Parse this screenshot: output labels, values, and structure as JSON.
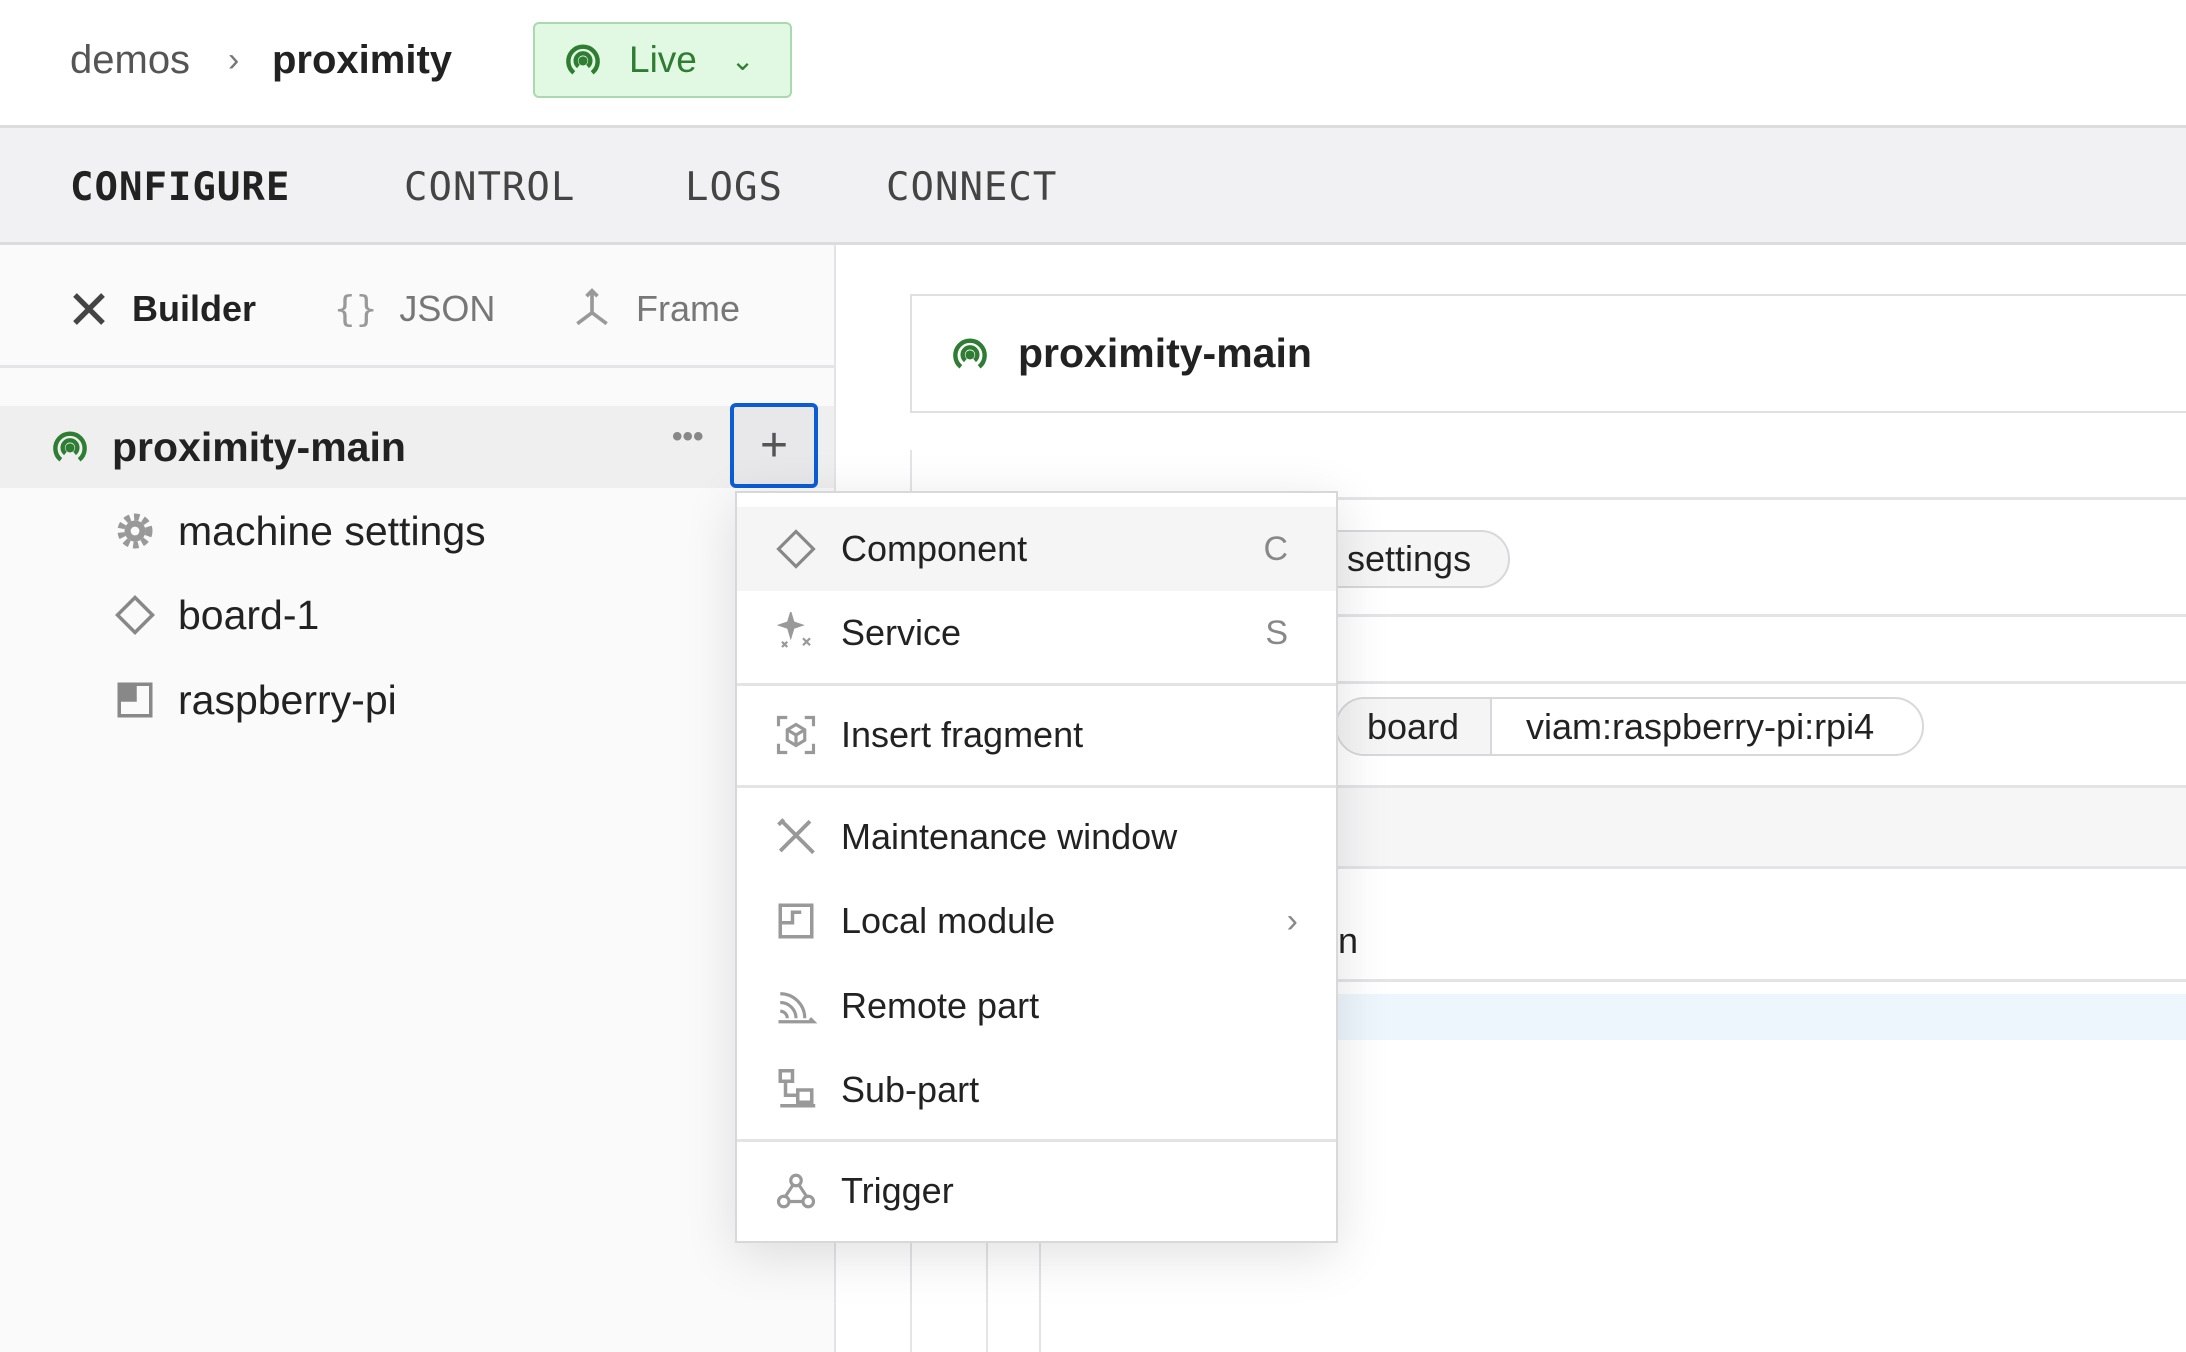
{
  "breadcrumb": {
    "org": "demos",
    "machine": "proximity"
  },
  "status": {
    "label": "Live",
    "color": "#2e7d32"
  },
  "tabs": [
    {
      "label": "CONFIGURE",
      "active": true
    },
    {
      "label": "CONTROL"
    },
    {
      "label": "LOGS"
    },
    {
      "label": "CONNECT"
    }
  ],
  "subtabs": [
    {
      "label": "Builder",
      "icon": "tools-icon",
      "active": true
    },
    {
      "label": "JSON",
      "icon": "braces-icon"
    },
    {
      "label": "Frame",
      "icon": "frame-axes-icon"
    }
  ],
  "tree": {
    "part": "proximity-main",
    "items": [
      {
        "label": "machine settings",
        "icon": "gear-icon"
      },
      {
        "label": "board-1",
        "icon": "diamond-icon"
      },
      {
        "label": "raspberry-pi",
        "icon": "module-icon"
      }
    ]
  },
  "menu": {
    "items": [
      {
        "label": "Component",
        "shortcut": "C",
        "icon": "diamond-icon"
      },
      {
        "label": "Service",
        "shortcut": "S",
        "icon": "sparkle-icon"
      },
      {
        "label": "Insert fragment",
        "icon": "fragment-icon"
      },
      {
        "label": "Maintenance window",
        "icon": "tools-icon"
      },
      {
        "label": "Local module",
        "icon": "module-icon",
        "submenu": true
      },
      {
        "label": "Remote part",
        "icon": "remote-icon"
      },
      {
        "label": "Sub-part",
        "icon": "subpart-icon"
      },
      {
        "label": "Trigger",
        "icon": "webhook-icon"
      }
    ]
  },
  "main": {
    "title": "proximity-main",
    "settings_pill": "settings",
    "board_type": "board",
    "board_model": "viam:raspberry-pi:rpi4",
    "partial_text": "n"
  }
}
